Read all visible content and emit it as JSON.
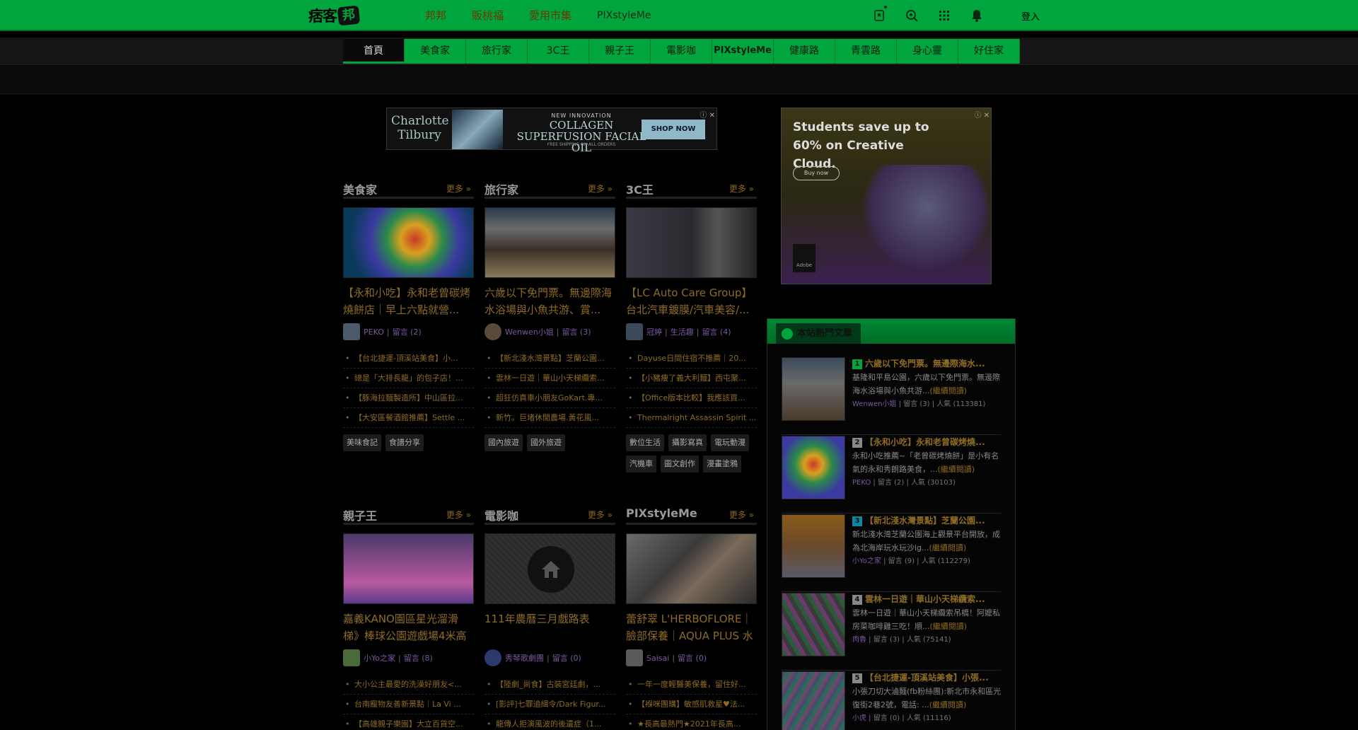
{
  "topbar": {
    "logo_text": "痞客",
    "logo_badge": "邦",
    "nav": [
      "邦邦",
      "販桃福",
      "愛用市集",
      "PIXstyleMe"
    ],
    "login": "登入"
  },
  "categories": [
    "首頁",
    "美食家",
    "旅行家",
    "3C王",
    "親子王",
    "電影咖",
    "PIXstyleMe",
    "健康路",
    "青雲路",
    "身心靈",
    "好住家"
  ],
  "ads": {
    "ad1": {
      "brand": "Charlotte Tilbury",
      "line1": "NEW INNOVATION",
      "line2": "COLLAGEN SUPERFUSION FACIAL OIL",
      "line3": "FREE SHIPPING ON ALL ORDERS",
      "cta": "SHOP NOW"
    },
    "ad2": {
      "text": "Students save up to 60% on Creative Cloud.",
      "cta": "Buy now",
      "brand": "Adobe"
    }
  },
  "sections": [
    {
      "title": "美食家",
      "more": "更多 »",
      "article_title": "【永和小吃】永和老曾碳烤燒餅店｜早上六點就營...",
      "author": "PEKO",
      "comments": "留言 (2)",
      "list": [
        "【台北捷運-頂溪站美食】小...",
        "總是「大排長龍」的包子店！...",
        "【豚海拉麵製造所】中山區拉...",
        "【大安區餐酒館推薦】Settle ..."
      ],
      "tags": [
        "美味食記",
        "食譜分享"
      ]
    },
    {
      "title": "旅行家",
      "more": "更多 »",
      "article_title": "六歲以下免門票。無邊際海水浴場與小魚共游、賞...",
      "author": "Wenwen小姐",
      "comments": "留言 (3)",
      "list": [
        "【新北淺水灣景點】芝蘭公園...",
        "雲林一日遊｜華山小天梯纜索...",
        "超狂仿真車小朋友GoKart.專...",
        "新竹。巨堵休閒農場.黃花風..."
      ],
      "tags": [
        "國內旅遊",
        "國外旅遊"
      ]
    },
    {
      "title": "3C王",
      "more": "更多 »",
      "article_title": "【LC Auto Care Group】台北汽車鍍膜/汽車美容/...",
      "author": "冠婷",
      "category": "生活趣",
      "comments": "留言 (4)",
      "list": [
        "Dayuse日間住宿不推薦｜20...",
        "【小豬痩了義大利麵】西屯聚...",
        "【Office版本比較】我應該買...",
        "Thermalright Assassin Spirit ..."
      ],
      "tags": [
        "數位生活",
        "攝影寫真",
        "電玩動漫",
        "汽機車",
        "圖文創作",
        "漫畫塗鴉"
      ]
    },
    {
      "title": "親子王",
      "more": "更多 »",
      "article_title": "嘉義KANO園區星光溜滑梯》棒球公園遊戲場4米高",
      "author": "小Yo之家",
      "comments": "留言 (8)",
      "list": [
        "大小公主最愛的洗澡好朋友<...",
        "台南寵物友善新景點｜La Vi ...",
        "【高雄親子樂園】大立百貨空..."
      ],
      "tags": []
    },
    {
      "title": "電影咖",
      "more": "更多 »",
      "article_title": "111年農曆三月戲路表",
      "author": "秀琴歌劇團",
      "comments": "留言 (0)",
      "list": [
        "【陸劇_尚食】古裝宮廷劇，...",
        "[影評]七罪追緝令/Dark Figur...",
        "龍傳人拒演風波的後遺症（1..."
      ],
      "tags": []
    },
    {
      "title": "PIXstyleMe",
      "more": "更多 »",
      "article_title": "蕾舒翠 L'HERBOFLORE｜臉部保養｜AQUA PLUS 水",
      "author": "Saisai",
      "comments": "留言 (0)",
      "list": [
        "一年一度輕醫美保養，留住好...",
        "【褓咪團購】敏感肌救星♥法...",
        "★長高最熱門★2021年長高..."
      ],
      "tags": []
    }
  ],
  "hot": {
    "title": "本站熱門文章",
    "items": [
      {
        "rank": "1",
        "title": "六歲以下免門票。無邊際海水...",
        "desc": "基隆和平島公園，六歲以下免門票。無邊際海水浴場與小魚共游...",
        "more": "(繼續閱讀)",
        "author": "Wenwen小姐",
        "comments": "留言 (3)",
        "views": "人氣 (113381)"
      },
      {
        "rank": "2",
        "title": "【永和小吃】永和老曾碳烤燒...",
        "desc": "永和小吃推薦~「老曾碳烤燒餅」是小有名氣的永和秀朗路美食，...",
        "more": "(繼續閱讀)",
        "author": "PEKO",
        "comments": "留言 (2)",
        "views": "人氣 (30103)"
      },
      {
        "rank": "3",
        "title": "【新北淺水灣景點】芝蘭公園...",
        "desc": "新北淺水灣芝蘭公園海上觀景平台開放，成為北海岸玩水玩沙ig...",
        "more": "(繼續閱讀)",
        "author": "小Yo之家",
        "comments": "留言 (9)",
        "views": "人氣 (112279)"
      },
      {
        "rank": "4",
        "title": "雲林一日遊｜華山小天梯纜索...",
        "desc": "雲林一日遊｜華山小天梯纜索吊橋！阿嬤私房菜咖啡雞三吃！順...",
        "more": "(繼續閱讀)",
        "author": "肉魯",
        "comments": "留言 (3)",
        "views": "人氣 (75141)"
      },
      {
        "rank": "5",
        "title": "【台北捷運-頂溪站美食】小張...",
        "desc": "小張刀切大滷麵(fb粉絲團):新北市永和區光復街2巷2號，電話: ...",
        "more": "(繼續閱讀)",
        "author": "小虎",
        "comments": "留言 (0)",
        "views": "人氣 (11116)"
      }
    ]
  }
}
